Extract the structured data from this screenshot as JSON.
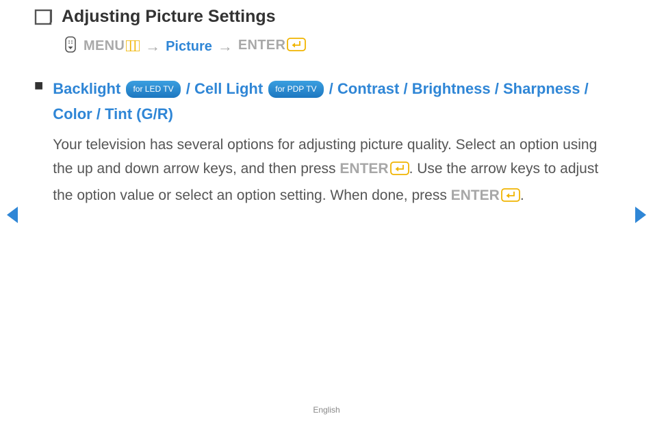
{
  "title": "Adjusting Picture Settings",
  "nav": {
    "menu_label": "MENU",
    "picture_label": "Picture",
    "enter_label": "ENTER",
    "arrow": "→"
  },
  "options": {
    "backlight": "Backlight",
    "badge_led": "for LED TV",
    "cell_light": "Cell Light",
    "badge_pdp": "for PDP TV",
    "contrast": "Contrast",
    "brightness": "Brightness",
    "sharpness": "Sharpness",
    "color": "Color",
    "tint": "Tint (G/R)",
    "sep": " / "
  },
  "body": {
    "part1": "Your television has several options for adjusting picture quality. Select an option using the up and down arrow keys, and then press ",
    "enter1": "ENTER",
    "part2": ". Use the arrow keys to adjust the option value or select an option setting. When done, press ",
    "enter2": "ENTER",
    "part3": "."
  },
  "footer": {
    "language": "English"
  }
}
